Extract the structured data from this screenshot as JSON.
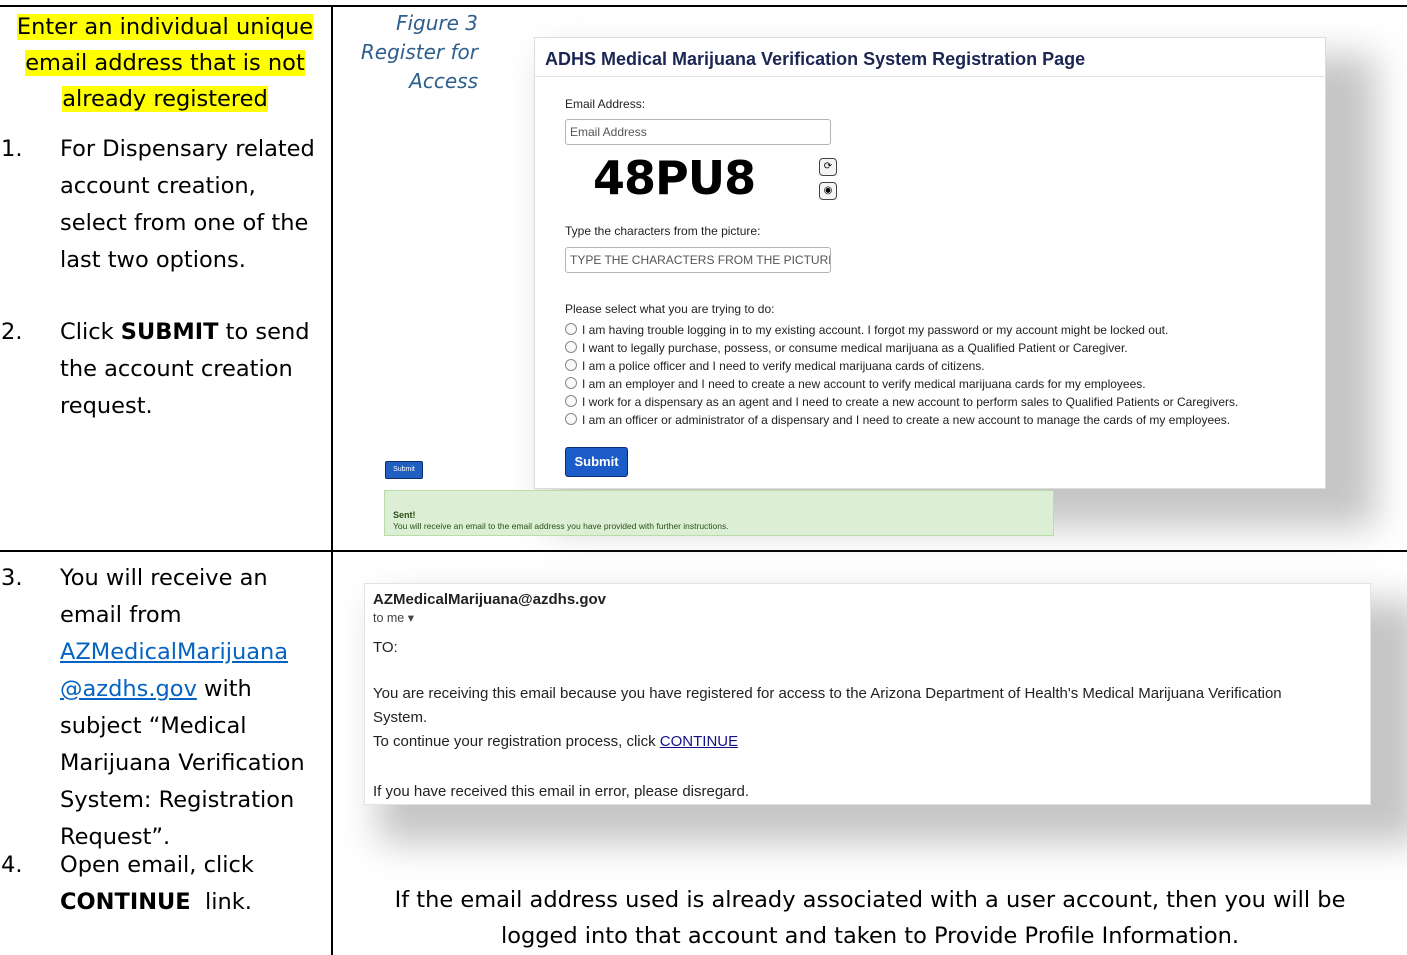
{
  "left_top": {
    "highlight_lines": [
      "Enter an individual unique",
      "email address that is not",
      "already registered"
    ],
    "steps": [
      {
        "num": "1.",
        "lines": [
          "For Dispensary related",
          "account creation,",
          "select from one of the",
          "last two options."
        ]
      },
      {
        "num": "2.",
        "prefix": "Click ",
        "bold": "SUBMIT",
        "suffix": " to send",
        "lines": [
          "the account creation",
          "request."
        ]
      }
    ]
  },
  "caption": [
    "Figure 3",
    "Register for",
    "Access"
  ],
  "registration": {
    "title": "ADHS Medical Marijuana Verification System Registration Page",
    "email_label": "Email Address:",
    "email_placeholder": "Email Address",
    "captcha_text": "48PU8",
    "captcha_refresh_icon": "refresh-icon",
    "captcha_audio_icon": "audio-icon",
    "chars_label": "Type the characters from the picture:",
    "chars_placeholder": "TYPE THE CHARACTERS FROM THE PICTURE",
    "select_label": "Please select what you are trying to do:",
    "options": [
      "I am having trouble logging in to my existing account. I forgot my password or my account might be locked out.",
      "I want to legally purchase, possess, or consume medical marijuana as a Qualified Patient or Caregiver.",
      "I am a police officer and I need to verify medical marijuana cards of citizens.",
      "I am an employer and I need to create a new account to verify medical marijuana cards for my employees.",
      "I work for a dispensary as an agent and I need to create a new account to perform sales to Qualified Patients or Caregivers.",
      "I am an officer or administrator of a dispensary and I need to create a new account to manage the cards of my employees."
    ],
    "submit_label": "Submit",
    "small_submit_label": "Submit",
    "sent_title": "Sent!",
    "sent_message": "You will receive an email to the email address you have provided with further instructions."
  },
  "left_bottom": {
    "step3": {
      "num": "3.",
      "lines": [
        "You will receive an",
        "email from"
      ],
      "link_lines": [
        "AZMedicalMarijuana",
        "@azdhs.gov"
      ],
      "after_link": " with",
      "rest_lines": [
        "subject “Medical",
        "Marijuana Verification",
        "System: Registration",
        "Request”."
      ]
    },
    "step4": {
      "num": "4.",
      "line1": "Open email, click",
      "bold": "CONTINUE",
      "after_bold": "  link."
    }
  },
  "email": {
    "from": "AZMedicalMarijuana@azdhs.gov",
    "to_me": "to me ▾",
    "to_line": "TO:",
    "body_line1": "You are receiving this email because you have registered for access to the Arizona Department of Health's Medical Marijuana Verification",
    "body_line2": "System.",
    "continue_prefix": "To continue your registration process, click ",
    "continue_link": "CONTINUE",
    "error_line": "If you have received this email in error, please disregard."
  },
  "footnote": [
    "If the email address used is already associated with a user account, then you will be",
    "logged into that account and taken to Provide Profile Information."
  ]
}
